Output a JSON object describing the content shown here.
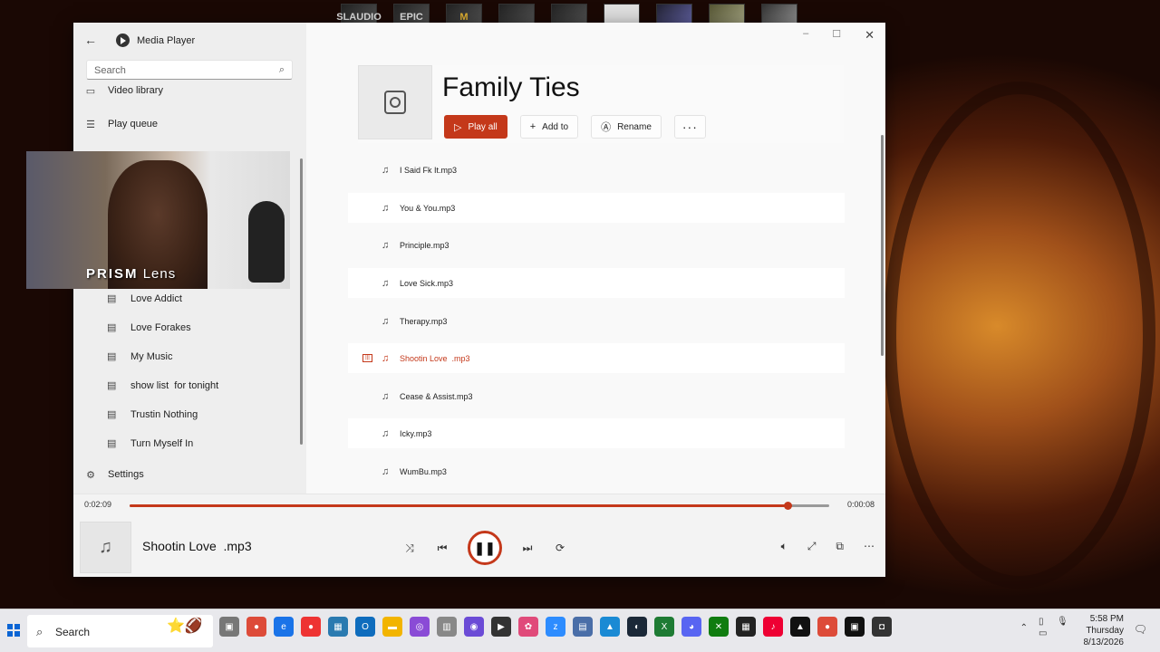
{
  "desktop": {
    "shortcuts": [
      "SLAUDIO",
      "EPIC",
      "M",
      "",
      "",
      "",
      "",
      "",
      ""
    ]
  },
  "window": {
    "app_title": "Media Player",
    "search_placeholder": "Search",
    "controls": {
      "minimize": "–",
      "maximize": "☐",
      "close": "✕"
    }
  },
  "sidebar": {
    "nav_top": [
      {
        "icon": "video-icon",
        "label": "Video library"
      },
      {
        "icon": "queue-icon",
        "label": "Play queue"
      }
    ],
    "playlists": [
      {
        "label": "Love Addict"
      },
      {
        "label": "Love Forakes"
      },
      {
        "label": "My Music"
      },
      {
        "label": "show list  for tonight"
      },
      {
        "label": "Trustin Nothing"
      },
      {
        "label": "Turn Myself In"
      }
    ],
    "settings_label": "Settings"
  },
  "webcam": {
    "brand": "PRISM",
    "suffix": "Lens"
  },
  "playlist": {
    "title": "Family Ties",
    "buttons": {
      "play_all": "Play all",
      "add_to": "Add to",
      "rename": "Rename",
      "more": "···"
    },
    "tracks": [
      {
        "name": "I Said Fk It.mp3"
      },
      {
        "name": "You & You.mp3"
      },
      {
        "name": "Principle.mp3"
      },
      {
        "name": "Love Sick.mp3"
      },
      {
        "name": "Therapy.mp3"
      },
      {
        "name": "Shootin Love  .mp3"
      },
      {
        "name": "Cease & Assist.mp3"
      },
      {
        "name": "Icky.mp3"
      },
      {
        "name": "WumBu.mp3"
      }
    ],
    "active_index": 5
  },
  "player": {
    "elapsed": "0:02:09",
    "remaining": "0:00:08",
    "progress_fraction": 0.94,
    "now_playing": "Shootin Love  .mp3",
    "accent": "#c4381a"
  },
  "taskbar": {
    "search_label": "Search",
    "time": "5:58 PM",
    "day": "Thursday",
    "date": "8/13/2026"
  }
}
